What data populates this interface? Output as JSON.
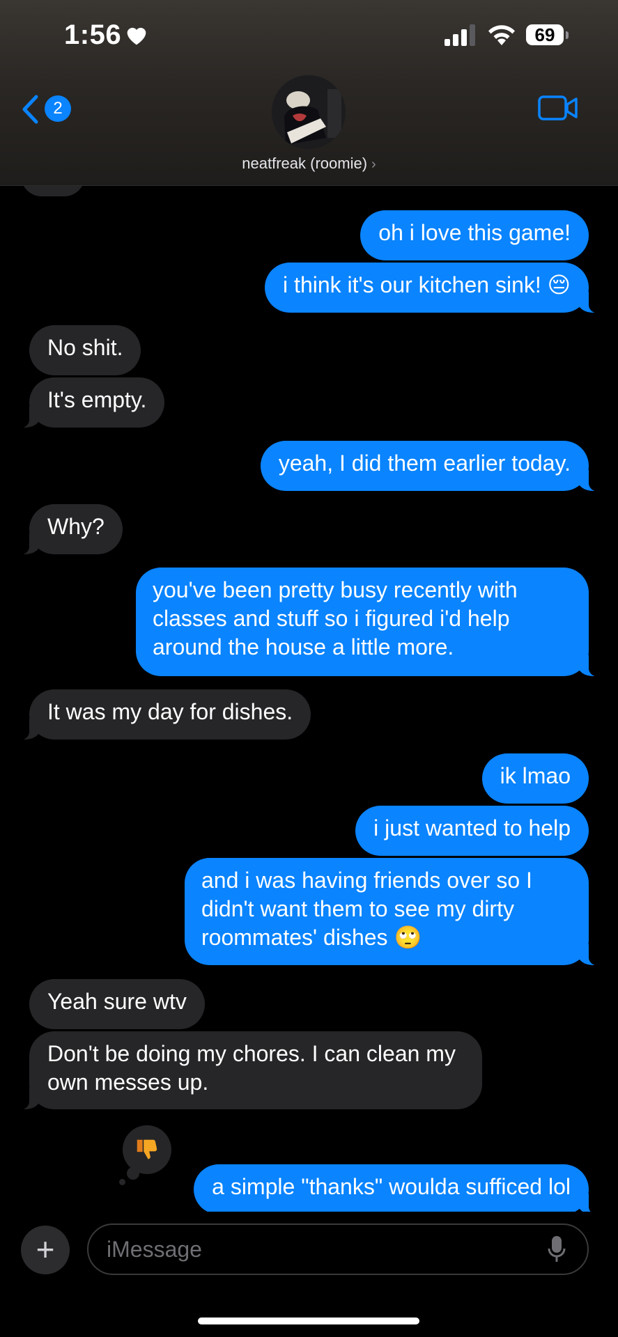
{
  "status_bar": {
    "time": "1:56",
    "battery": "69",
    "icons": [
      "heart-icon",
      "signal-icon",
      "wifi-icon",
      "battery-icon"
    ]
  },
  "header": {
    "back_badge": "2",
    "contact_name": "neatfreak (roomie)",
    "chevron": "›",
    "icons": [
      "back-chevron-icon",
      "video-camera-icon"
    ]
  },
  "messages": [
    {
      "from": "me",
      "text": "oh i love this game!"
    },
    {
      "from": "me",
      "text": "i think it's our kitchen sink! 😔"
    },
    {
      "from": "them",
      "text": "No shit."
    },
    {
      "from": "them",
      "text": "It's empty."
    },
    {
      "from": "me",
      "text": "yeah, I did them earlier today."
    },
    {
      "from": "them",
      "text": "Why?"
    },
    {
      "from": "me",
      "text": "you've been pretty busy recently with classes and stuff so i figured i'd help around the house a little more."
    },
    {
      "from": "them",
      "text": "It was my day for dishes."
    },
    {
      "from": "me",
      "text": "ik lmao"
    },
    {
      "from": "me",
      "text": "i just wanted to help"
    },
    {
      "from": "me",
      "text": "and i was having friends over so I didn't want them to see my dirty roommates' dishes 🙄"
    },
    {
      "from": "them",
      "text": "Yeah sure wtv"
    },
    {
      "from": "them",
      "text": "Don't be doing my chores. I can clean my own messes up."
    },
    {
      "from": "me",
      "text": "a simple \"thanks\" woulda sufficed lol",
      "reaction": "thumbs-down-icon"
    }
  ],
  "composer": {
    "placeholder": "iMessage",
    "plus": "+",
    "icons": [
      "plus-icon",
      "microphone-icon"
    ]
  },
  "colors": {
    "sent": "#0a84ff",
    "received": "#262628",
    "background": "#000000"
  }
}
